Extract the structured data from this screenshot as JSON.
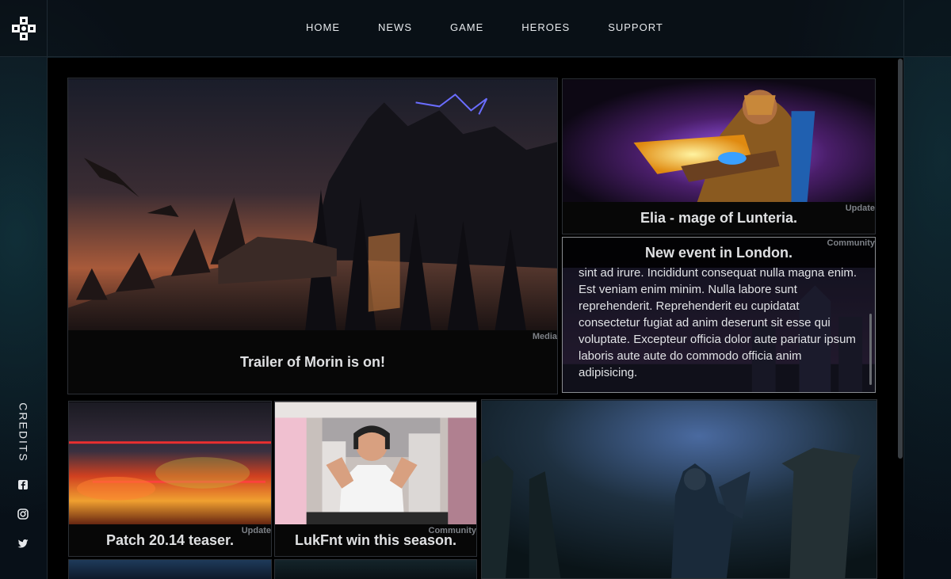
{
  "nav": {
    "items": [
      "HOME",
      "NEWS",
      "GAME",
      "HEROES",
      "SUPPORT"
    ]
  },
  "sidebar": {
    "credits": "CREDITS",
    "social_icons": [
      "facebook-icon",
      "instagram-icon",
      "twitter-icon"
    ]
  },
  "cards": {
    "trailer": {
      "title": "Trailer of Morin is on!",
      "tag": "Media"
    },
    "elia": {
      "title": "Elia - mage of Lunteria.",
      "tag": "Update"
    },
    "event": {
      "title": "New event in London.",
      "tag": "Community",
      "body": "sint ad irure. Incididunt consequat nulla magna enim. Est veniam enim minim. Nulla labore sunt reprehenderit. Reprehenderit eu cupidatat consectetur fugiat ad anim deserunt sit esse qui voluptate. Excepteur officia dolor aute pariatur ipsum laboris aute aute do commodo officia anim adipisicing."
    },
    "patch": {
      "title": "Patch 20.14 teaser.",
      "tag": "Update"
    },
    "lukfnt": {
      "title": "LukFnt win this season.",
      "tag": "Community"
    }
  },
  "colors": {
    "background": "#0b1017",
    "caption_bg": "#070707",
    "tag_text": "#7d8187"
  }
}
